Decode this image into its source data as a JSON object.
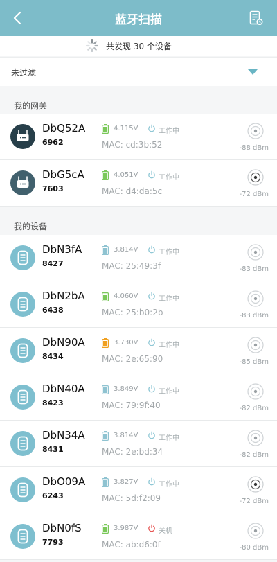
{
  "header": {
    "title": "蓝牙扫描"
  },
  "scan": {
    "found_text": "共发现 30 个设备"
  },
  "filter": {
    "label": "未过滤"
  },
  "sections": {
    "gateways": "我的网关",
    "devices": "我的设备"
  },
  "gateways": [
    {
      "name": "DbQ52A",
      "code": "6962",
      "voltage": "4.115V",
      "status": "工作中",
      "mac": "MAC: cd:3b:52",
      "rssi": "-88 dBm",
      "battery": "green",
      "signal": "weak"
    },
    {
      "name": "DbG5cA",
      "code": "7603",
      "voltage": "4.051V",
      "status": "工作中",
      "mac": "MAC: d4:da:5c",
      "rssi": "-72 dBm",
      "battery": "green",
      "signal": "strong"
    }
  ],
  "devices": [
    {
      "name": "DbN3fA",
      "code": "8427",
      "voltage": "3.814V",
      "status": "工作中",
      "mac": "MAC: 25:49:3f",
      "rssi": "-83 dBm",
      "battery": "blue",
      "signal": "weak"
    },
    {
      "name": "DbN2bA",
      "code": "6438",
      "voltage": "4.060V",
      "status": "工作中",
      "mac": "MAC: 25:b0:2b",
      "rssi": "-83 dBm",
      "battery": "green",
      "signal": "weak"
    },
    {
      "name": "DbN90A",
      "code": "8434",
      "voltage": "3.730V",
      "status": "工作中",
      "mac": "MAC: 2e:65:90",
      "rssi": "-85 dBm",
      "battery": "orange",
      "signal": "weak"
    },
    {
      "name": "DbN40A",
      "code": "8423",
      "voltage": "3.849V",
      "status": "工作中",
      "mac": "MAC: 79:9f:40",
      "rssi": "-82 dBm",
      "battery": "blue",
      "signal": "weak"
    },
    {
      "name": "DbN34A",
      "code": "8431",
      "voltage": "3.814V",
      "status": "工作中",
      "mac": "MAC: 2e:bd:34",
      "rssi": "-82 dBm",
      "battery": "blue",
      "signal": "weak"
    },
    {
      "name": "DbO09A",
      "code": "6243",
      "voltage": "3.827V",
      "status": "工作中",
      "mac": "MAC: 5d:f2:09",
      "rssi": "-72 dBm",
      "battery": "blue",
      "signal": "strong"
    },
    {
      "name": "DbN0fS",
      "code": "7793",
      "voltage": "3.987V",
      "status": "关机",
      "mac": "MAC: ab:d6:0f",
      "rssi": "-80 dBm",
      "battery": "green",
      "signal": "weak"
    }
  ],
  "colors": {
    "accent": "#7dbcc9",
    "battery_green": "#7bc85a",
    "battery_blue": "#8fc3d1",
    "battery_orange": "#f0a020",
    "status_on": "#8cc6d4",
    "status_off": "#e5514f",
    "gateway_avatar_1": "#273f4a",
    "gateway_avatar_2": "#41606d",
    "device_avatar": "#7ebfcf"
  },
  "icons": {
    "back": "chevron-left-icon",
    "report": "report-icon",
    "spinner": "loading-spinner-icon",
    "filter_toggle": "caret-down-icon",
    "gateway": "gateway-icon",
    "device": "tag-device-icon",
    "battery": "battery-icon",
    "power": "power-icon",
    "signal": "signal-icon"
  }
}
